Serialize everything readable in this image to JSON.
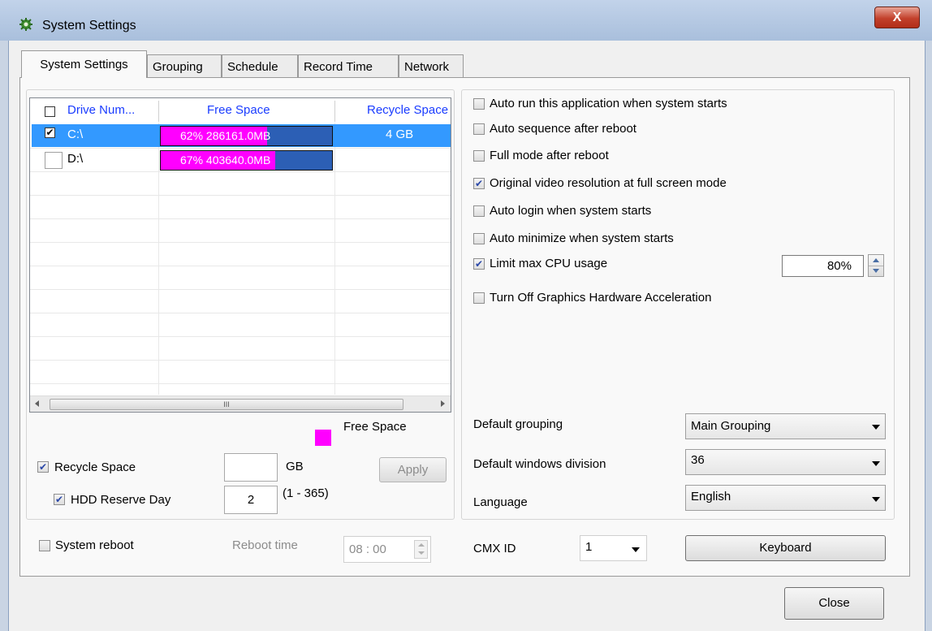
{
  "window": {
    "title": "System Settings",
    "close_glyph": "X"
  },
  "tabs": [
    "System Settings",
    "Grouping",
    "Schedule",
    "Record Time",
    "Network"
  ],
  "drive_table": {
    "columns": [
      "Drive Num...",
      "Free Space",
      "Recycle Space"
    ],
    "rows": [
      {
        "checked": true,
        "drive": "C:\\",
        "free_percent": 62,
        "free_text": "62%   286161.0MB",
        "recycle": "4 GB",
        "selected": true
      },
      {
        "checked": false,
        "drive": "D:\\",
        "free_percent": 67,
        "free_text": "67%   403640.0MB",
        "recycle": "",
        "selected": false
      }
    ],
    "scroll_thumb_glyph": "III"
  },
  "legend": {
    "label": "Free Space",
    "color": "#ff00ff"
  },
  "recycle": {
    "recycle_label": "Recycle Space",
    "recycle_checked": true,
    "recycle_value": "",
    "unit": "GB",
    "apply_label": "Apply",
    "reserve_label": "HDD Reserve Day",
    "reserve_checked": true,
    "reserve_value": "2",
    "reserve_range": "(1 - 365)"
  },
  "options": {
    "auto_run": "Auto run this application when system starts",
    "auto_sequence": "Auto sequence after reboot",
    "full_mode": "Full mode after reboot",
    "original_resolution": "Original video resolution at full screen mode",
    "auto_login": "Auto login when system starts",
    "auto_minimize": "Auto minimize when system starts",
    "limit_cpu": "Limit max CPU usage",
    "cpu_value": "80%",
    "graphics_accel": "Turn Off Graphics Hardware Acceleration"
  },
  "defaults": {
    "grouping_label": "Default grouping",
    "grouping_value": "Main Grouping",
    "division_label": "Default windows division",
    "division_value": "36",
    "language_label": "Language",
    "language_value": "English"
  },
  "bottom": {
    "reboot_label": "System reboot",
    "reboot_time_label": "Reboot time",
    "reboot_time_value": "08 : 00",
    "cmx_label": "CMX ID",
    "cmx_value": "1",
    "keyboard_label": "Keyboard"
  },
  "close_label": "Close",
  "colors": {
    "accent_header": "#1a3cff",
    "selection": "#3399ff",
    "free_space": "#ff00ff",
    "used_space": "#2c5fb5"
  }
}
